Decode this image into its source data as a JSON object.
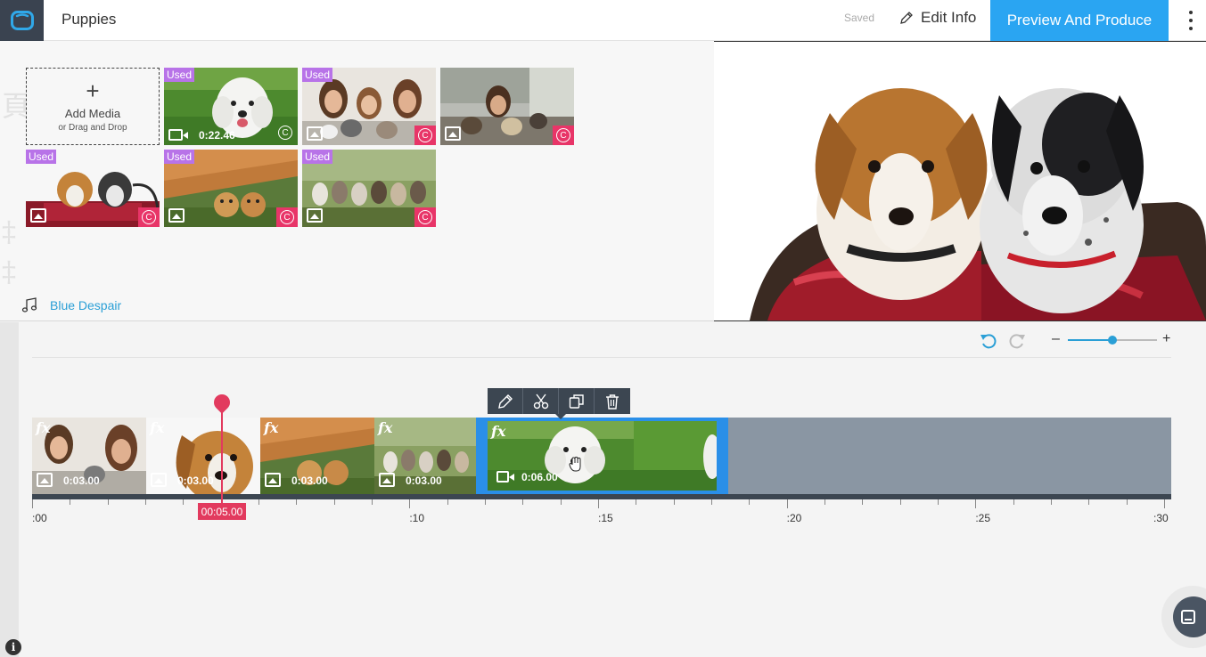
{
  "app": {
    "project_title": "Puppies",
    "save_status": "Saved",
    "edit_info_label": "Edit Info",
    "produce_label": "Preview And Produce"
  },
  "library": {
    "add_media_label": "Add Media",
    "add_media_sub": "or Drag and Drop",
    "used_badge": "Used",
    "items": [
      {
        "type": "video",
        "used": true,
        "duration": "0:22.46",
        "thumb": "white-fluffy-puppy"
      },
      {
        "type": "image",
        "used": true,
        "thumb": "women-with-puppies"
      },
      {
        "type": "image",
        "used": false,
        "thumb": "woman-with-puppies-porch"
      },
      {
        "type": "image",
        "used": true,
        "thumb": "two-puppies-basket"
      },
      {
        "type": "image",
        "used": true,
        "thumb": "puppies-under-wood"
      },
      {
        "type": "image",
        "used": true,
        "thumb": "row-of-puppies"
      }
    ],
    "music_track": "Blue Despair"
  },
  "timeline": {
    "clips": [
      {
        "duration": "0:03.00",
        "type": "image",
        "fx": "fx"
      },
      {
        "duration": "0:03.00",
        "type": "image",
        "fx": "fx"
      },
      {
        "duration": "0:03.00",
        "type": "image",
        "fx": "fx"
      },
      {
        "duration": "0:03.00",
        "type": "image",
        "fx": "fx"
      },
      {
        "duration": "0:06.00",
        "type": "video",
        "fx": "fx",
        "selected": true
      }
    ],
    "playhead_time": "00:05.00",
    "ruler_labels": [
      ":00",
      ":10",
      ":15",
      ":20",
      ":25",
      ":30"
    ],
    "zoom_level": 0.5
  },
  "colors": {
    "accent": "#2aa5f2",
    "used_badge": "#b873e8",
    "copyright": "#e83568",
    "playhead": "#e23a5e",
    "selection": "#2a8fe8"
  }
}
